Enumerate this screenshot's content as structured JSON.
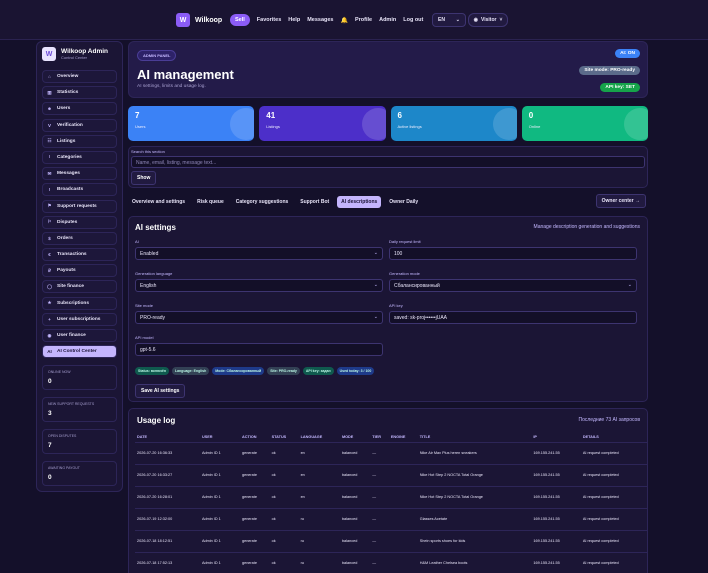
{
  "topbar": {
    "logo_letter": "W",
    "brand": "Wilkoop",
    "nav": [
      "Sell",
      "Favorites",
      "Help",
      "Messages",
      "Profile",
      "Admin",
      "Log out"
    ],
    "bell": "🔔",
    "lang": "EN",
    "visitor": "Visitor"
  },
  "sidebar": {
    "logo_letter": "W",
    "title": "Wilkoop Admin",
    "subtitle": "Control Center",
    "items": [
      {
        "icon": "⌂",
        "label": "Overview"
      },
      {
        "icon": "▥",
        "label": "Statistics"
      },
      {
        "icon": "☻",
        "label": "Users"
      },
      {
        "icon": "V",
        "label": "Verification"
      },
      {
        "icon": "☷",
        "label": "Listings"
      },
      {
        "icon": "⁝",
        "label": "Categories"
      },
      {
        "icon": "✉",
        "label": "Messages"
      },
      {
        "icon": "!",
        "label": "Broadcasts"
      },
      {
        "icon": "⚑",
        "label": "Support requests"
      },
      {
        "icon": "⚐",
        "label": "Disputes"
      },
      {
        "icon": "$",
        "label": "Orders"
      },
      {
        "icon": "€",
        "label": "Transactions"
      },
      {
        "icon": "₽",
        "label": "Payouts"
      },
      {
        "icon": "◯",
        "label": "Site finance"
      },
      {
        "icon": "★",
        "label": "Subscriptions"
      },
      {
        "icon": "+",
        "label": "User subscriptions"
      },
      {
        "icon": "◉",
        "label": "User finance"
      },
      {
        "icon": "AI",
        "label": "AI Control Center"
      }
    ],
    "stats": [
      {
        "label": "ONLINE NOW",
        "value": "0"
      },
      {
        "label": "NEW SUPPORT REQUESTS",
        "value": "3"
      },
      {
        "label": "OPEN DISPUTES",
        "value": "7"
      },
      {
        "label": "AWAITING PAYOUT",
        "value": "0"
      }
    ]
  },
  "hero": {
    "badge": "ADMIN PANEL",
    "title": "AI management",
    "subtitle": "AI settings, limits and usage log.",
    "ai_on": "AI: ON",
    "site_mode": "Site mode: PRO-ready",
    "api_key": "API key: SET"
  },
  "cards": [
    {
      "value": "7",
      "label": "Users"
    },
    {
      "value": "41",
      "label": "Listings"
    },
    {
      "value": "6",
      "label": "Active listings"
    },
    {
      "value": "0",
      "label": "Online"
    }
  ],
  "search": {
    "label": "Search this section",
    "placeholder": "Name, email, listing, message text...",
    "button": "Show"
  },
  "tabs": [
    "Overview and settings",
    "Risk queue",
    "Category suggestions",
    "Support Bot",
    "AI descriptions",
    "Owner Daily"
  ],
  "owner_center": "Owner center →",
  "settings": {
    "title": "AI settings",
    "hint": "Manage description generation and suggestions",
    "ai_label": "AI",
    "ai_value": "Enabled",
    "limit_label": "Daily request limit",
    "limit_value": "100",
    "genlang_label": "Generation language",
    "genlang_value": "English",
    "genmode_label": "Generation mode",
    "genmode_value": "Сбалансированный",
    "sitemode_label": "Site mode",
    "sitemode_value": "PRO-ready",
    "apikey_label": "API key",
    "apikey_value": "saved: sk-proj••••••jUAA",
    "model_label": "API model",
    "model_value": "gpt-5.6",
    "chips": [
      "Status: включён",
      "Language: English",
      "Mode: Сбалансированный",
      "Site: PRO-ready",
      "API key: задан",
      "Used today: 3 / 100"
    ],
    "save": "Save AI settings"
  },
  "usage": {
    "title": "Usage log",
    "count": "Последние 73 AI запросов",
    "headers": [
      "DATE",
      "USER",
      "ACTION",
      "STATUS",
      "LANGUAGE",
      "MODE",
      "TIER",
      "ENGINE",
      "TITLE",
      "IP",
      "DETAILS"
    ],
    "rows": [
      [
        "2026-07-20 16:36:33",
        "Admin ID 1",
        "generate",
        "ok",
        "en",
        "balanced",
        "—",
        "",
        "Nike Air Max Plus heren sneakers",
        "169.155.241.55",
        "AI request completed"
      ],
      [
        "2026-07-20 16:33:27",
        "Admin ID 1",
        "generate",
        "ok",
        "en",
        "balanced",
        "—",
        "",
        "Nike Hot Step 2 NOCTA Total Orange",
        "169.155.241.55",
        "AI request completed"
      ],
      [
        "2026-07-20 16:28:01",
        "Admin ID 1",
        "generate",
        "ok",
        "en",
        "balanced",
        "—",
        "",
        "Nike Hot Step 2 NOCTA Total Orange",
        "169.155.241.55",
        "AI request completed"
      ],
      [
        "2026-07-19 12:32:00",
        "Admin ID 1",
        "generate",
        "ok",
        "ru",
        "balanced",
        "—",
        "",
        "Glasses Acetate",
        "169.155.241.55",
        "AI request completed"
      ],
      [
        "2026-07-18 18:12:51",
        "Admin ID 1",
        "generate",
        "ok",
        "ru",
        "balanced",
        "—",
        "",
        "Shein sports shoes for kids",
        "169.155.241.55",
        "AI request completed"
      ],
      [
        "2026-07-18 17:52:13",
        "Admin ID 1",
        "generate",
        "ok",
        "ru",
        "balanced",
        "—",
        "",
        "H&M Leather Chelsea boots",
        "169.155.241.55",
        "AI request completed"
      ]
    ]
  }
}
